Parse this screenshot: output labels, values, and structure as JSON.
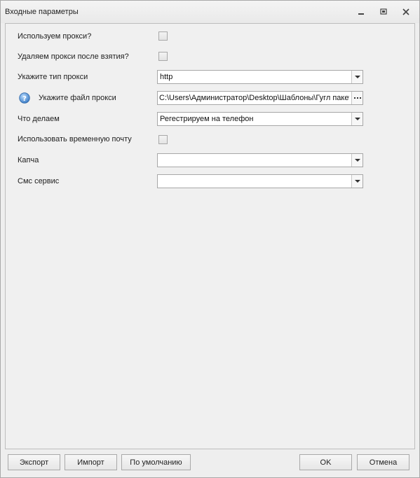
{
  "window": {
    "title": "Входные параметры"
  },
  "form": {
    "use_proxy": {
      "label": "Используем прокси?",
      "checked": false
    },
    "delete_proxy": {
      "label": "Удаляем прокси после взятия?",
      "checked": false
    },
    "proxy_type": {
      "label": "Укажите тип прокси",
      "value": "http"
    },
    "proxy_file": {
      "label": "Укажите файл прокси",
      "value": "C:\\Users\\Администратор\\Desktop\\Шаблоны\\Гугл пакет\\"
    },
    "action": {
      "label": "Что делаем",
      "value": "Регестрируем на телефон"
    },
    "temp_mail": {
      "label": "Использовать временную почту",
      "checked": false
    },
    "captcha": {
      "label": "Капча",
      "value": ""
    },
    "sms_service": {
      "label": "Смс сервис",
      "value": ""
    }
  },
  "buttons": {
    "export": "Экспорт",
    "import": "Импорт",
    "defaults": "По умолчанию",
    "ok": "OK",
    "cancel": "Отмена"
  },
  "icons": {
    "minimize": "minimize-icon",
    "maximize": "maximize-icon",
    "close": "close-icon",
    "help": "help-icon",
    "dropdown": "chevron-down-icon",
    "browse": "ellipsis-icon"
  },
  "colors": {
    "help_icon": "#4a90d9"
  }
}
